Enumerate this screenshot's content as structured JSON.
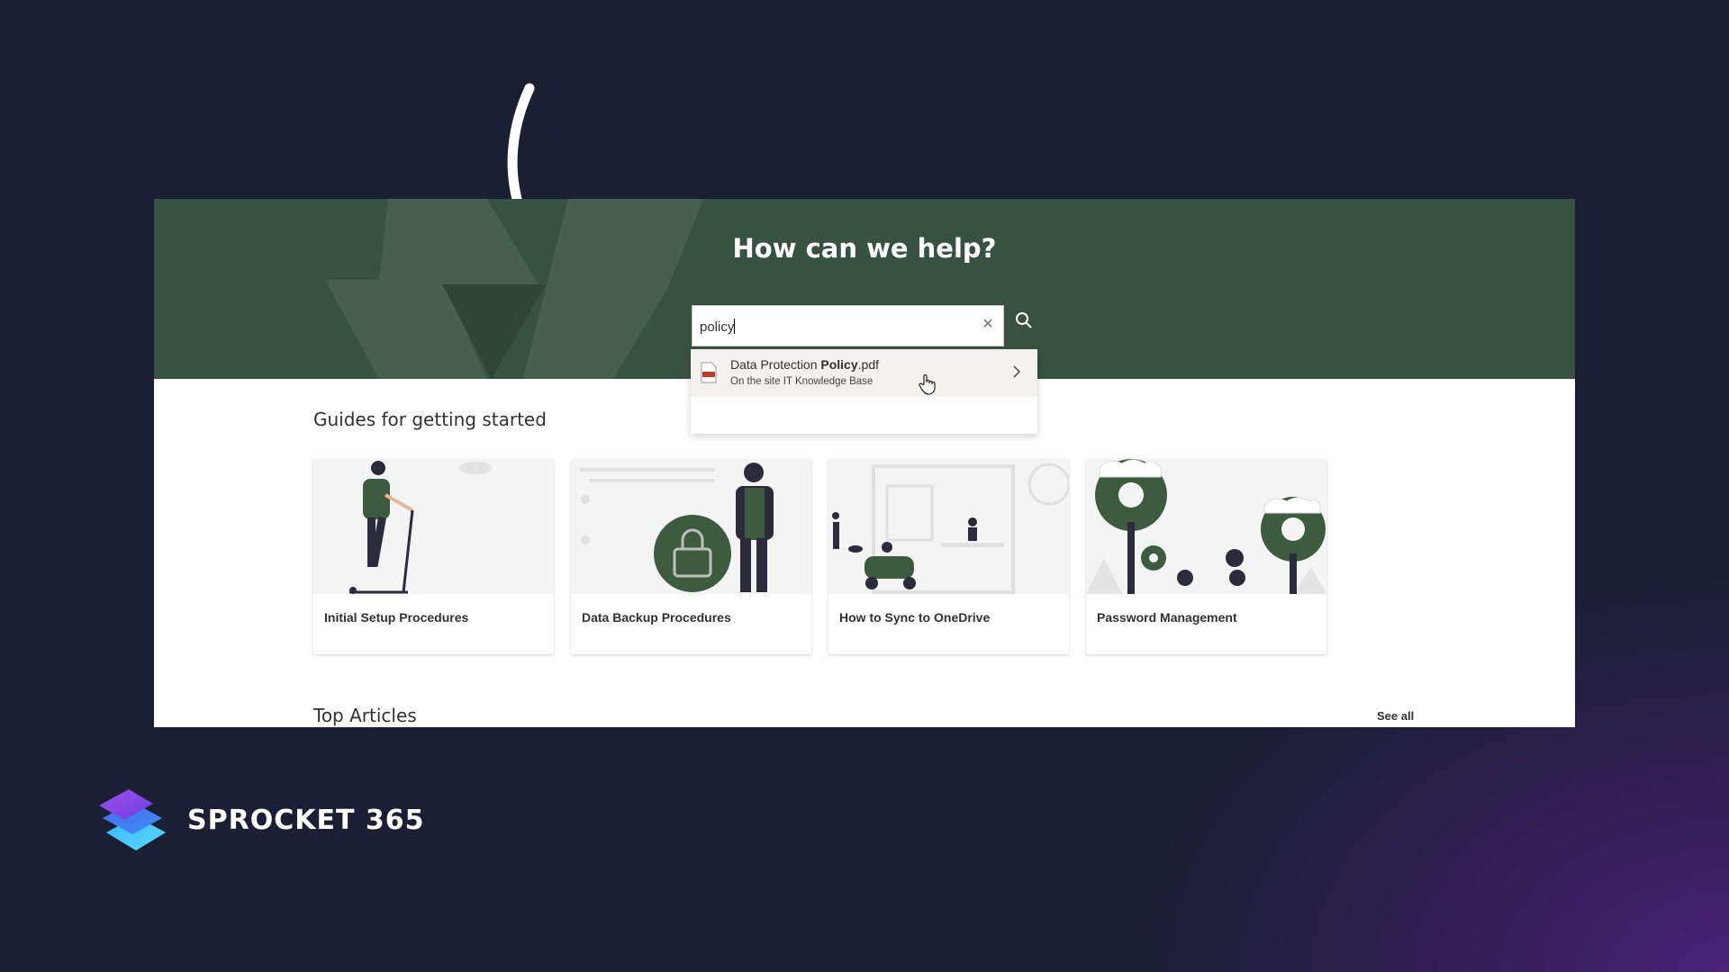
{
  "hero": {
    "title": "How can we help?"
  },
  "search": {
    "value": "policy"
  },
  "suggestion": {
    "name_prefix": "Data Protection ",
    "name_bold": "Policy",
    "name_suffix": ".pdf",
    "site": "On the site IT Knowledge Base"
  },
  "guides": {
    "title": "Guides for getting started",
    "cards": [
      {
        "label": "Initial Setup Procedures"
      },
      {
        "label": "Data Backup Procedures"
      },
      {
        "label": "How to Sync to OneDrive"
      },
      {
        "label": "Password Management"
      }
    ]
  },
  "top_articles": {
    "title": "Top Articles",
    "see_all": "See all"
  },
  "brand": {
    "name": "SPROCKET 365"
  },
  "colors": {
    "hero": "#385241",
    "accent_green": "#3d5c3f",
    "background": "#1a1f30",
    "purple": "#4a2378"
  }
}
